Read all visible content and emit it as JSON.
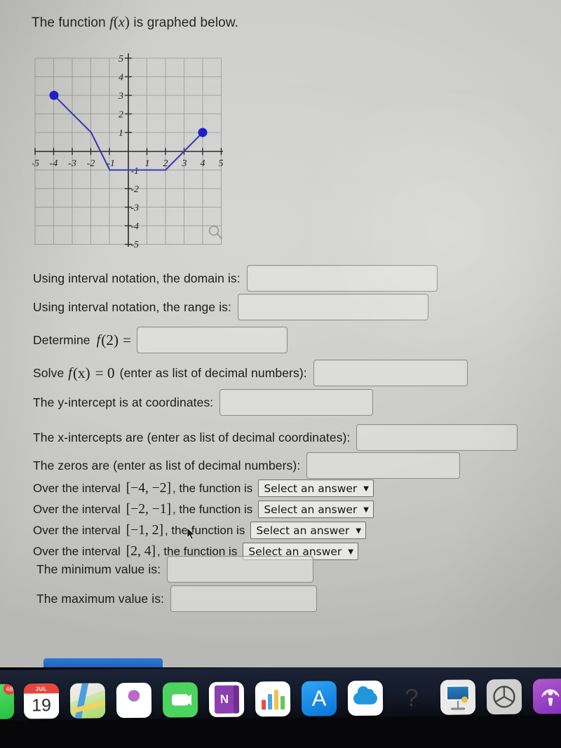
{
  "prompt": {
    "before": "The function",
    "func": "f",
    "open": "(",
    "var": "x",
    "close": ")",
    "after": "is graphed below."
  },
  "chart_data": {
    "type": "line",
    "title": "",
    "xlabel": "",
    "ylabel": "",
    "xlim": [
      -5,
      5
    ],
    "ylim": [
      -5,
      5
    ],
    "grid": true,
    "legend": null,
    "x_ticks": [
      -5,
      -4,
      -3,
      -2,
      -1,
      1,
      2,
      3,
      4,
      5
    ],
    "y_ticks": [
      5,
      4,
      3,
      2,
      1,
      -1,
      -2,
      -3,
      -4,
      -5
    ],
    "x_tick_labels": [
      "-5",
      "-4",
      "-3",
      "-2",
      "-1",
      "1",
      "2",
      "3",
      "4",
      "5"
    ],
    "y_tick_labels": [
      "5",
      "4",
      "3",
      "2",
      "1",
      "-1",
      "-2",
      "-3",
      "-4",
      "-5"
    ],
    "line_color": "#3a3ab4",
    "point_color": "#1a1ad0",
    "series": [
      {
        "name": "f(x)",
        "points": [
          {
            "x": -4,
            "y": 3
          },
          {
            "x": -2,
            "y": 1
          },
          {
            "x": -1,
            "y": -1
          },
          {
            "x": 2,
            "y": -1
          },
          {
            "x": 4,
            "y": 1
          }
        ]
      }
    ],
    "closed_endpoints": [
      {
        "x": -4,
        "y": 3
      },
      {
        "x": 4,
        "y": 1
      }
    ],
    "magnifier_icon": "magnifier-icon"
  },
  "questions": {
    "domain": {
      "label": "Using interval notation, the domain is:",
      "value": "",
      "placeholder": ""
    },
    "range": {
      "label": "Using interval notation, the range is:",
      "value": "",
      "placeholder": ""
    },
    "determine": {
      "label_before": "Determine",
      "func": "f",
      "arg": "(2)",
      "equals": "=",
      "value": "",
      "placeholder": ""
    },
    "solve": {
      "label_before": "Solve",
      "func": "f",
      "arg": "(x)",
      "equals": "= 0",
      "label_after": "(enter as list of decimal numbers):",
      "value": "",
      "placeholder": ""
    },
    "y_intercept": {
      "label": "The y-intercept is at coordinates:",
      "value": "",
      "placeholder": ""
    },
    "x_intercepts": {
      "label": "The x-intercepts are (enter as list of decimal coordinates):",
      "value": "",
      "placeholder": ""
    },
    "zeros": {
      "label": "The zeros are (enter as list of decimal numbers):",
      "value": "",
      "placeholder": ""
    },
    "minimum": {
      "label": "The minimum value is:",
      "value": "",
      "placeholder": ""
    },
    "maximum": {
      "label": "The maximum value is:",
      "value": "",
      "placeholder": ""
    }
  },
  "intervals": {
    "prefix": "Over the interval",
    "suffix": ", the function is",
    "select_placeholder": "Select an answer",
    "caret": "⌄",
    "rows": [
      {
        "interval": "[−4, −2]",
        "selected": "Select an answer"
      },
      {
        "interval": "[−2, −1]",
        "selected": "Select an answer"
      },
      {
        "interval": "[−1, 2]",
        "selected": "Select an answer"
      },
      {
        "interval": "[2, 4]",
        "selected": "Select an answer"
      }
    ]
  },
  "dock": {
    "items": [
      {
        "name": "messages",
        "label": "Messages",
        "badge": "48"
      },
      {
        "name": "calendar",
        "label": "Calendar",
        "month": "JUL",
        "day": "19"
      },
      {
        "name": "maps",
        "label": "Maps"
      },
      {
        "name": "photos",
        "label": "Photos"
      },
      {
        "name": "facetime",
        "label": "FaceTime"
      },
      {
        "name": "onenote",
        "label": "OneNote",
        "glyph": "N"
      },
      {
        "name": "numbers",
        "label": "Numbers"
      },
      {
        "name": "app-store",
        "label": "App Store",
        "glyph": "A"
      },
      {
        "name": "icloud-drive",
        "label": "iCloud Drive"
      },
      {
        "name": "help",
        "label": "Help",
        "glyph": "?"
      },
      {
        "name": "keynote",
        "label": "Keynote"
      },
      {
        "name": "gray-app",
        "label": "App"
      },
      {
        "name": "podcasts",
        "label": "Podcasts"
      }
    ]
  },
  "colors": {
    "graph_line": "#3a3ab4",
    "graph_point": "#1a1ad0",
    "page_bg": "#cdcdcb",
    "input_border": "#8c8c8a",
    "dock_bg": "#141a29"
  }
}
